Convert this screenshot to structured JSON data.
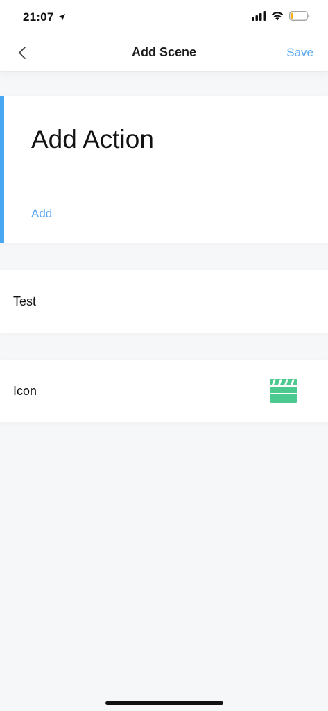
{
  "status_bar": {
    "time": "21:07",
    "icons": [
      "location-arrow-icon",
      "cellular-signal-icon",
      "wifi-icon",
      "battery-low-icon"
    ]
  },
  "nav": {
    "title": "Add Scene",
    "save_label": "Save",
    "back_icon": "chevron-left-icon"
  },
  "action_card": {
    "title": "Add Action",
    "add_label": "Add"
  },
  "rows": {
    "name_value": "Test",
    "icon_label": "Icon",
    "icon_name": "clapperboard-icon"
  },
  "colors": {
    "accent_blue": "#4aa8f3",
    "link_blue": "#5aa7f0",
    "icon_green": "#4cc98e",
    "battery_fill": "#f5b323"
  }
}
